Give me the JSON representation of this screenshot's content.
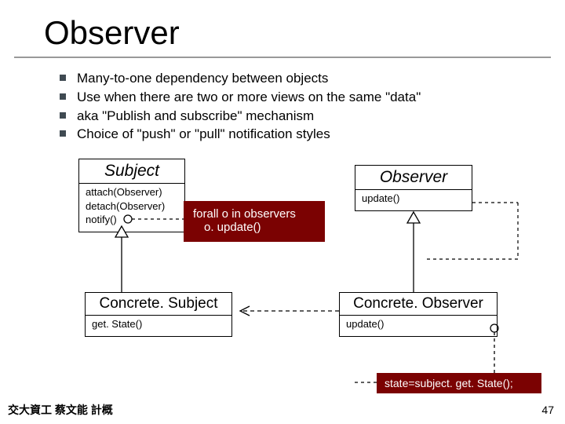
{
  "title": "Observer",
  "bullets": [
    "Many-to-one dependency between objects",
    "Use when there are two or more views on the same \"data\"",
    "aka \"Publish and subscribe\" mechanism",
    "Choice of \"push\" or \"pull\" notification styles"
  ],
  "uml": {
    "subject": {
      "title": "Subject",
      "ops": [
        "attach(Observer)",
        "detach(Observer)",
        "notify()"
      ]
    },
    "observer": {
      "title": "Observer",
      "ops": [
        "update()"
      ]
    },
    "concrete_subject": {
      "title": "Concrete. Subject",
      "ops": [
        "get. State()"
      ]
    },
    "concrete_observer": {
      "title": "Concrete. Observer",
      "ops": [
        "update()"
      ]
    },
    "note_notify": {
      "line1": "forall o in observers",
      "line2": "o. update()"
    },
    "note_state": "state=subject. get. State();"
  },
  "footer": {
    "left": "交大資工 蔡文能 計概",
    "right": "47"
  }
}
